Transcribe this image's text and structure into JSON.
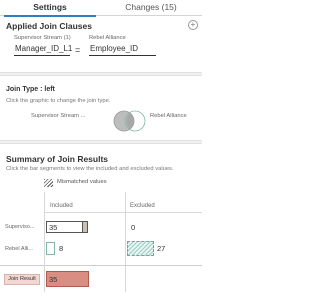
{
  "tabs": [
    {
      "label": "Settings",
      "active": true
    },
    {
      "label": "Changes (15)",
      "active": false
    }
  ],
  "applied_clauses": {
    "title": "Applied Join Clauses",
    "left_source": "Supervisor Stream (1)",
    "right_source": "Rebel Alliance",
    "left_field": "Manager_ID_L1",
    "operator": "=",
    "right_field": "Employee_ID",
    "add_icon": "plus-circle-icon",
    "add_symbol": "+"
  },
  "join_type": {
    "title": "Join Type : left",
    "hint": "Click the graphic to change the join type.",
    "left_label": "Supervisor Stream ...",
    "right_label": "Rebel Alliance",
    "selected": "left"
  },
  "summary": {
    "title": "Summary of Join Results",
    "hint": "Click the bar segments to view the included and excluded values.",
    "mismatch_label": "Mismatched values",
    "columns": [
      "Included",
      "Excluded"
    ],
    "rows": [
      {
        "label": "Superviso...",
        "included": "35",
        "excluded": "0"
      },
      {
        "label": "Rebel Alli...",
        "included": "8",
        "excluded": "27"
      }
    ],
    "result": {
      "label": "Join Result",
      "value": "35"
    }
  },
  "colors": {
    "accent": "#2f7fbf",
    "result_fill": "#d98e83",
    "rebel_excluded": "#9fcfc2",
    "supervisor_mismatch": "#c9c1b3"
  }
}
